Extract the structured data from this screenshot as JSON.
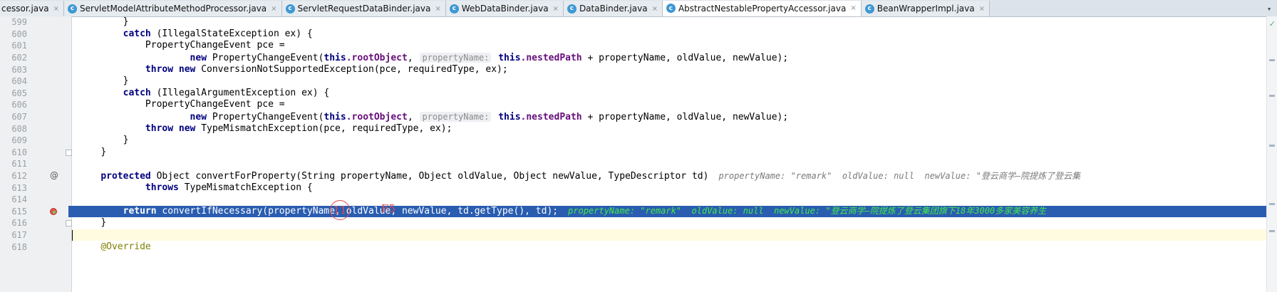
{
  "tabs": [
    {
      "label": "cessor.java",
      "active": false
    },
    {
      "label": "ServletModelAttributeMethodProcessor.java",
      "active": false
    },
    {
      "label": "ServletRequestDataBinder.java",
      "active": false
    },
    {
      "label": "WebDataBinder.java",
      "active": false
    },
    {
      "label": "DataBinder.java",
      "active": false
    },
    {
      "label": "AbstractNestablePropertyAccessor.java",
      "active": true
    },
    {
      "label": "BeanWrapperImpl.java",
      "active": false
    }
  ],
  "tab_icon_glyph": "c",
  "tab_close_glyph": "×",
  "overflow_glyph": "▾",
  "lines": [
    {
      "num": "599",
      "text": "        }"
    },
    {
      "num": "600",
      "text": "        catch (IllegalStateException ex) {"
    },
    {
      "num": "601",
      "text": "            PropertyChangeEvent pce ="
    },
    {
      "num": "602",
      "text": "                    new PropertyChangeEvent(this.rootObject,"
    },
    {
      "num": "603",
      "text": "            throw new ConversionNotSupportedException(pce, requiredType, ex);"
    },
    {
      "num": "604",
      "text": "        }"
    },
    {
      "num": "605",
      "text": "        catch (IllegalArgumentException ex) {"
    },
    {
      "num": "606",
      "text": "            PropertyChangeEvent pce ="
    },
    {
      "num": "607",
      "text": "                    new PropertyChangeEvent(this.rootObject,"
    },
    {
      "num": "608",
      "text": "            throw new TypeMismatchException(pce, requiredType, ex);"
    },
    {
      "num": "609",
      "text": "        }"
    },
    {
      "num": "610",
      "text": "    }"
    },
    {
      "num": "611",
      "text": ""
    },
    {
      "num": "612",
      "text": "    protected Object convertForProperty(String propertyName, Object oldValue, Object newValue, TypeDescriptor td)"
    },
    {
      "num": "613",
      "text": "            throws TypeMismatchException {"
    },
    {
      "num": "614",
      "text": ""
    },
    {
      "num": "615",
      "text": "        return convertIfNecessary(propertyName, oldValue, newValue, td.getType(), td);"
    },
    {
      "num": "616",
      "text": "    }"
    },
    {
      "num": "617",
      "text": ""
    },
    {
      "num": "618",
      "text": "    @Override"
    }
  ],
  "code": {
    "l599": "}",
    "l600_kw": "catch",
    "l600_rest": " (IllegalStateException ex) {",
    "l601": "PropertyChangeEvent pce =",
    "l602_new": "new",
    "l602_mid": " PropertyChangeEvent(",
    "l602_this": "this",
    "l602_root": ".rootObject",
    "l602_comma": ",",
    "l602_hint": "propertyName:",
    "l602_this2": "this",
    "l602_nested": ".nestedPath",
    "l602_rest": " + propertyName, oldValue, newValue);",
    "l603_throw": "throw",
    "l603_new": "new",
    "l603_rest": " ConversionNotSupportedException(pce, requiredType, ex);",
    "l604": "}",
    "l605_kw": "catch",
    "l605_rest": " (IllegalArgumentException ex) {",
    "l606": "PropertyChangeEvent pce =",
    "l608_throw": "throw",
    "l608_new": "new",
    "l608_rest": " TypeMismatchException(pce, requiredType, ex);",
    "l609": "}",
    "l610": "}",
    "l612_kw": "protected",
    "l612_rest": " Object convertForProperty(String propertyName, Object oldValue, Object newValue, TypeDescriptor td)",
    "l612_dbg": "propertyName: \"remark\"  oldValue: null  newValue: \"登云商学—院提炼了登云集",
    "l613_kw": "throws",
    "l613_rest": " TypeMismatchException {",
    "l615_kw": "return",
    "l615_rest": " convertIfNecessary(propertyName, oldValue, newValue, td.getType(), td);",
    "l615_dbg": "propertyName: \"remark\"  oldValue: null  newValue: \"登云商学—院提炼了登云集团旗下18年3000多家美容养生",
    "l616": "}",
    "l618": "@Override"
  },
  "gutter_marker_612": "@",
  "annotation": {
    "step_number": "11",
    "step_key": "F5"
  },
  "colors": {
    "current_line_bg": "#2a5db0",
    "keyword": "#000080",
    "field": "#660e7a",
    "annotation_red": "#e14c4c",
    "debug_value_green": "#45e84d"
  }
}
